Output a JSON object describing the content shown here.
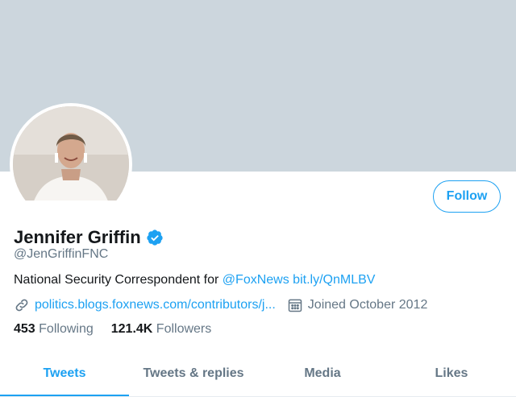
{
  "profile": {
    "name": "Jennifer Griffin",
    "handle": "@JenGriffinFNC",
    "verified": true,
    "follow_label": "Follow",
    "bio": {
      "text": "National Security Correspondent for ",
      "mention": "@FoxNews",
      "link": "bit.ly/QnMLBV"
    },
    "website": "politics.blogs.foxnews.com/contributors/j...",
    "joined": "Joined October 2012",
    "following_count": "453",
    "following_label": "Following",
    "followers_count": "121.4K",
    "followers_label": "Followers"
  },
  "tabs": [
    {
      "label": "Tweets",
      "active": true
    },
    {
      "label": "Tweets & replies",
      "active": false
    },
    {
      "label": "Media",
      "active": false
    },
    {
      "label": "Likes",
      "active": false
    }
  ],
  "colors": {
    "accent": "#1da1f2",
    "banner": "#ccd6dd",
    "secondary_text": "#657786"
  },
  "icons": {
    "verified": "verified-badge-icon",
    "website": "link-icon",
    "joined": "calendar-icon"
  }
}
